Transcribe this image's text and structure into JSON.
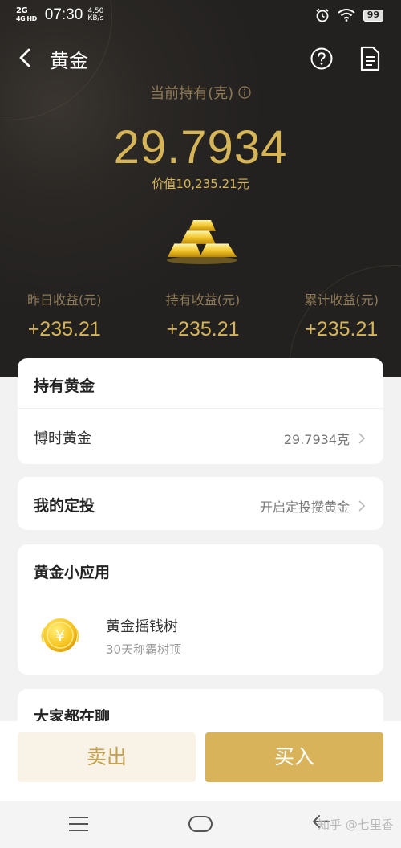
{
  "status_bar": {
    "network_top": "2G",
    "network_bottom": "4G HD",
    "time": "07:30",
    "speed_value": "4.50",
    "speed_unit": "KB/s",
    "battery": "99",
    "icons": [
      "alarm-icon",
      "wifi-icon",
      "battery-icon"
    ]
  },
  "header": {
    "title": "黄金",
    "back_icon": "chevron-left-icon",
    "help_icon": "question-circle-icon",
    "doc_icon": "document-icon"
  },
  "summary": {
    "holding_label": "当前持有(克)",
    "info_icon": "info-circle-icon",
    "holding_value": "29.7934",
    "worth": "价值10,235.21元",
    "image_icon": "gold-bars-icon",
    "stats": [
      {
        "label": "昨日收益(元)",
        "value": "+235.21"
      },
      {
        "label": "持有收益(元)",
        "value": "+235.21"
      },
      {
        "label": "累计收益(元)",
        "value": "+235.21"
      }
    ]
  },
  "holding_card": {
    "title": "持有黄金",
    "item_label": "博时黄金",
    "item_value": "29.7934克"
  },
  "plan_card": {
    "title": "我的定投",
    "action_text": "开启定投攒黄金"
  },
  "apps_card": {
    "title": "黄金小应用",
    "app_icon": "gold-coin-icon",
    "app_name": "黄金摇钱树",
    "app_desc": "30天称霸树顶"
  },
  "chat_card": {
    "title": "大家都在聊"
  },
  "actions": {
    "sell": "卖出",
    "buy": "买入"
  },
  "system_nav": {
    "icons": [
      "menu-icon",
      "home-icon",
      "back-icon"
    ],
    "watermark": "知乎 @七里香"
  },
  "colors": {
    "gold": "#d6b458",
    "gold_muted": "#8e7a55",
    "hero_bg": "#2a2724",
    "buy_button": "#d9b35a",
    "sell_button_bg": "#f8f3e6"
  }
}
